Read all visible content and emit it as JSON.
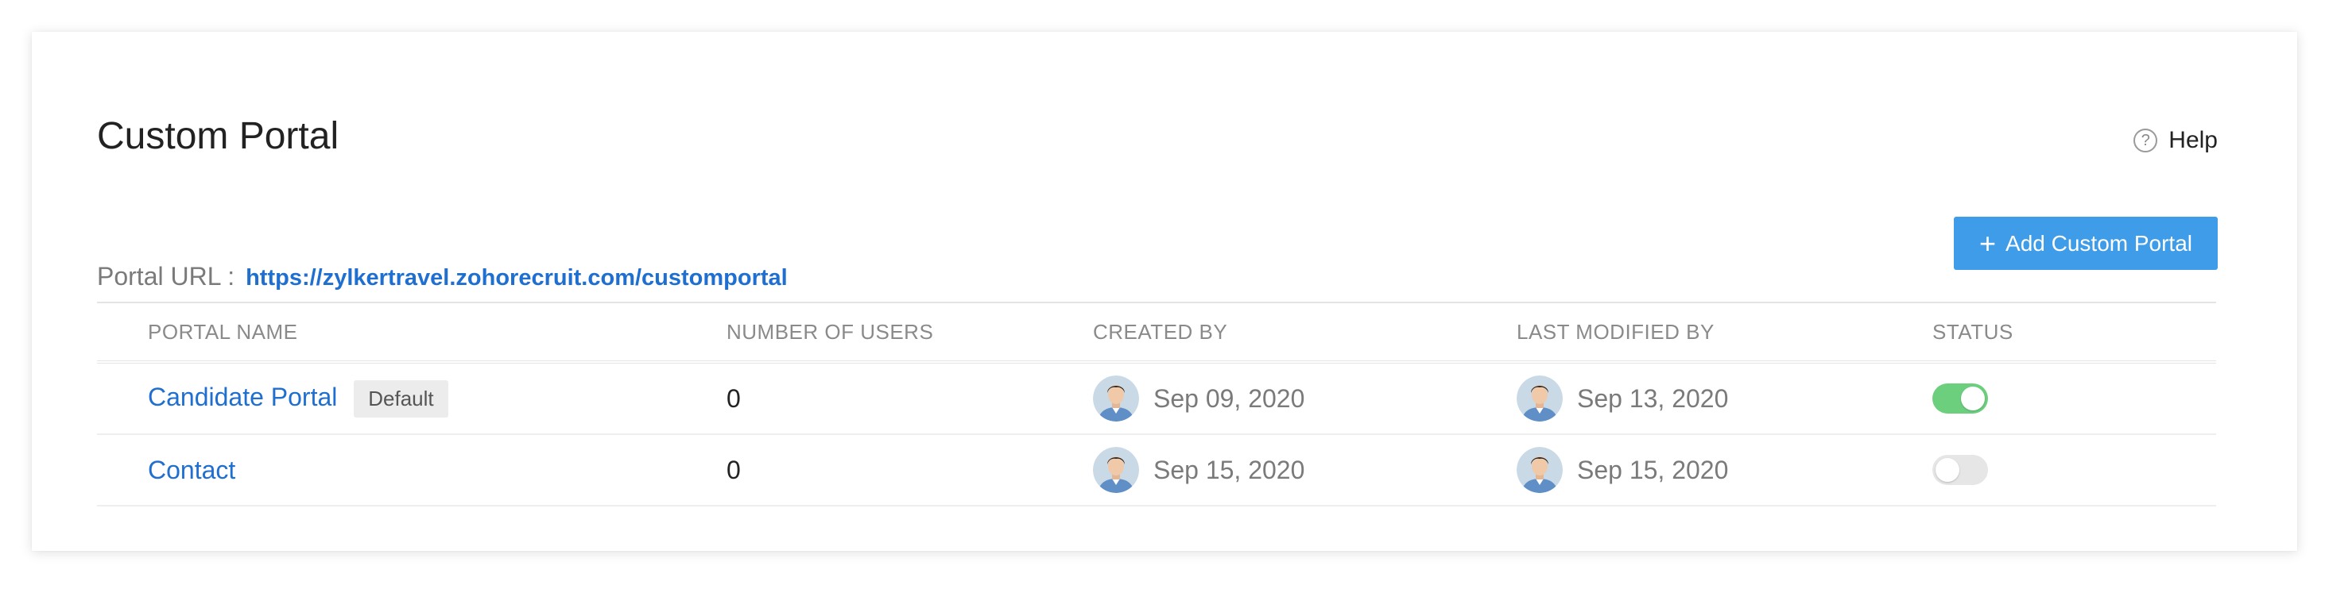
{
  "header": {
    "title": "Custom Portal",
    "help_label": "Help",
    "help_icon": "question-circle-icon"
  },
  "portal_url": {
    "label": "Portal URL :",
    "value": "https://zylkertravel.zohorecruit.com/customportal"
  },
  "add_button": {
    "icon": "plus-icon",
    "label": "Add Custom Portal",
    "color": "#3f9ce8"
  },
  "table": {
    "columns": [
      "PORTAL NAME",
      "NUMBER OF USERS",
      "CREATED BY",
      "LAST MODIFIED BY",
      "STATUS"
    ],
    "rows": [
      {
        "name": "Candidate Portal",
        "badge": "Default",
        "users": "0",
        "created": "Sep 09, 2020",
        "modified": "Sep 13, 2020",
        "status": "enabled"
      },
      {
        "name": "Contact",
        "badge": "",
        "users": "0",
        "created": "Sep 15, 2020",
        "modified": "Sep 15, 2020",
        "status": "disabled"
      }
    ]
  },
  "colors": {
    "link": "#1f6fd0",
    "toggle_on": "#6ccf7e",
    "toggle_off": "#e6e6e6"
  }
}
